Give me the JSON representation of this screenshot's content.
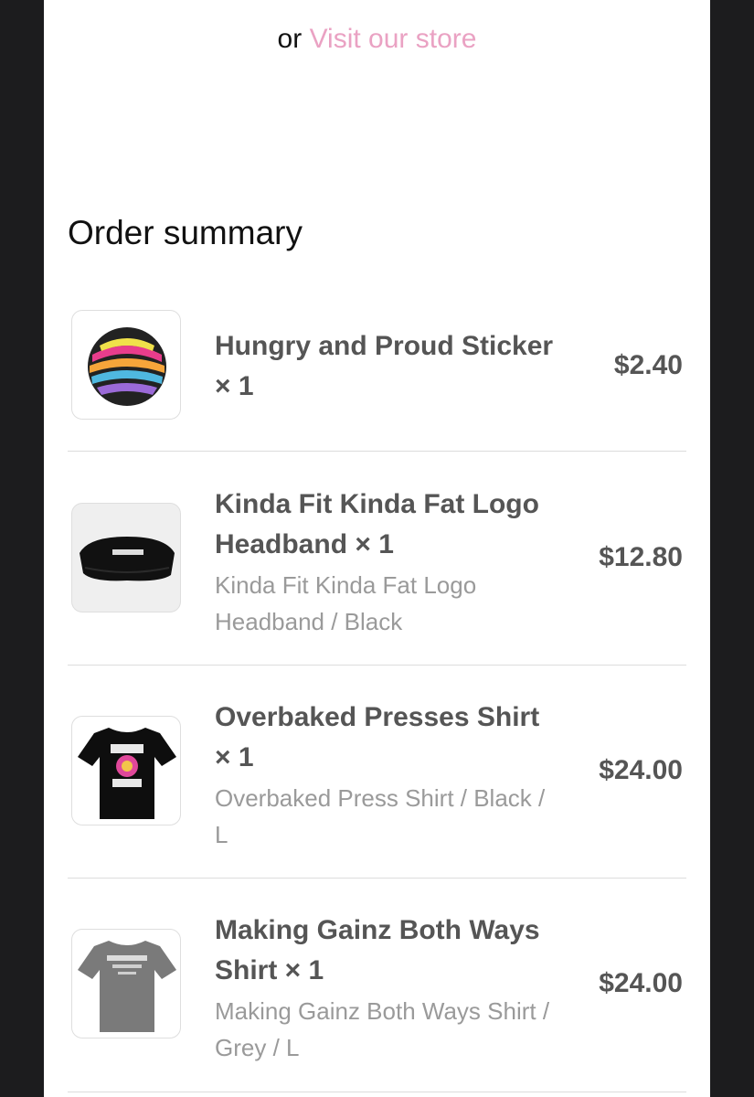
{
  "store": {
    "prefix": "or",
    "link_label": "Visit our store"
  },
  "summary": {
    "title": "Order summary"
  },
  "items": [
    {
      "name": "Hungry and Proud Sticker × 1",
      "variant": "",
      "price": "$2.40",
      "icon": "sticker-thumbnail"
    },
    {
      "name": "Kinda Fit Kinda Fat Logo Headband × 1",
      "variant": "Kinda Fit Kinda Fat Logo Headband / Black",
      "price": "$12.80",
      "icon": "headband-thumbnail"
    },
    {
      "name": "Overbaked Presses Shirt × 1",
      "variant": "Overbaked Press Shirt / Black / L",
      "price": "$24.00",
      "icon": "black-shirt-thumbnail"
    },
    {
      "name": "Making Gainz Both Ways Shirt × 1",
      "variant": "Making Gainz Both Ways Shirt / Grey / L",
      "price": "$24.00",
      "icon": "grey-shirt-thumbnail"
    }
  ],
  "colors": {
    "link": "#eaa2c3",
    "text": "#555555",
    "muted": "#9a9a9a",
    "frame": "#1c1c1e"
  }
}
